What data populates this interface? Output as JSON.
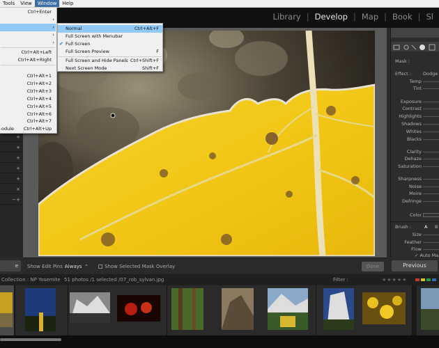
{
  "menubar": {
    "items": [
      "Tools",
      "View",
      "Window",
      "Help"
    ]
  },
  "modules": [
    "Library",
    "Develop",
    "Map",
    "Book",
    "Sl"
  ],
  "active_module": "Develop",
  "window_menu": {
    "shortcuts": {
      "top": "Ctrl+Enter",
      "left_side": "Ctrl+Alt+Left",
      "right_side": "Ctrl+Alt+Right",
      "m1": "Ctrl+Alt+1",
      "m2": "Ctrl+Alt+2",
      "m3": "Ctrl+Alt+3",
      "m4": "Ctrl+Alt+4",
      "m5": "Ctrl+Alt+5",
      "m6": "Ctrl+Alt+6",
      "m7": "Ctrl+Alt+7",
      "prev_module_label": "odule",
      "prev_module": "Ctrl+Alt+Up"
    }
  },
  "screen_mode_menu": {
    "items": [
      {
        "label": "Normal",
        "shortcut": "Ctrl+Alt+F",
        "checked": false
      },
      {
        "label": "Full Screen with Menubar",
        "shortcut": "",
        "checked": false
      },
      {
        "label": "Full Screen",
        "shortcut": "",
        "checked": true
      },
      {
        "label": "Full Screen Preview",
        "shortcut": "F",
        "checked": false
      },
      {
        "label": "Full Screen and Hide Panels",
        "shortcut": "Ctrl+Shift+F",
        "checked": false
      },
      {
        "label": "Next Screen Mode",
        "shortcut": "Shift+F",
        "checked": false
      }
    ]
  },
  "left_panel": {
    "button": "e"
  },
  "toolbar": {
    "show_edit_pins_label": "Show Edit Pins :",
    "show_edit_pins_value": "Always",
    "overlay_label": "Show Selected Mask Overlay",
    "done_label": "Done"
  },
  "right_panel": {
    "mask_label": "Mask :",
    "effect_label": "Effect :",
    "effect_value": "Dodge",
    "sliders": [
      "Temp",
      "Tint",
      "Exposure",
      "Contrast",
      "Highlights",
      "Shadows",
      "Whites",
      "Blacks",
      "Clarity",
      "Dehaze",
      "Saturation",
      "Sharpness",
      "Noise",
      "Moire",
      "Defringe"
    ],
    "color_label": "Color",
    "brush_label": "Brush :",
    "brush_a": "A",
    "brush_b": "B",
    "size_label": "Size",
    "feather_label": "Feather",
    "flow_label": "Flow",
    "automask_label": "Auto Ma",
    "previous_label": "Previous"
  },
  "filmstrip": {
    "collection": "Collection : NP Yosemite",
    "count": "51 photos /1 selected /07_rob_sylvan.jpg",
    "filter_label": "Filter :"
  },
  "colors": {
    "accent_blue": "#3a6ea5",
    "menu_highlight": "#91c9f7",
    "leaf_yellow": "#f2c81a"
  }
}
